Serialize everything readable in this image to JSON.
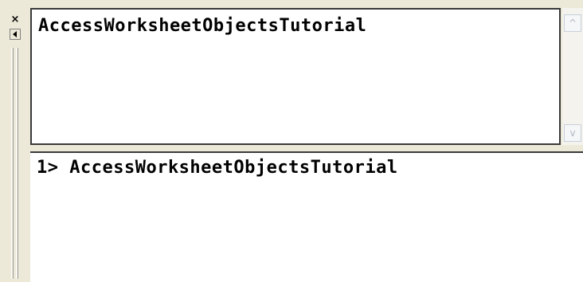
{
  "toolbar": {
    "close_glyph": "×"
  },
  "command_pane": {
    "text": "AccessWorksheetObjectsTutorial"
  },
  "scrollbar": {
    "up_glyph": "^",
    "down_glyph": "v"
  },
  "history": {
    "lines": [
      "1> AccessWorksheetObjectsTutorial"
    ]
  }
}
